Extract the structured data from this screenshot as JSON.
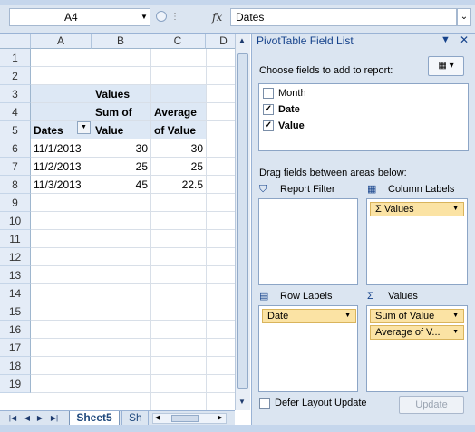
{
  "formula_bar": {
    "name_box": "A4",
    "fx_label": "fx",
    "formula": "Dates"
  },
  "grid": {
    "columns": [
      "A",
      "B",
      "C",
      "D"
    ],
    "rows": [
      "1",
      "2",
      "3",
      "4",
      "5",
      "6",
      "7",
      "8",
      "9",
      "10",
      "11",
      "12",
      "13",
      "14",
      "15",
      "16",
      "17",
      "18",
      "19"
    ],
    "pivot": {
      "values_header": "Values",
      "col_b_header_1": "Sum of",
      "col_b_header_2": "Value",
      "col_c_header_1": "Average",
      "col_c_header_2": "of Value",
      "row_label": "Dates",
      "data": [
        {
          "date": "11/1/2013",
          "sum": "30",
          "avg": "30"
        },
        {
          "date": "11/2/2013",
          "sum": "25",
          "avg": "25"
        },
        {
          "date": "11/3/2013",
          "sum": "45",
          "avg": "22.5"
        }
      ]
    }
  },
  "sheet_tabs": {
    "active": "Sheet5",
    "other": "Sh"
  },
  "pivot_pane": {
    "title": "PivotTable Field List",
    "choose_label": "Choose fields to add to report:",
    "fields": [
      {
        "name": "Month",
        "checked": false
      },
      {
        "name": "Date",
        "checked": true
      },
      {
        "name": "Value",
        "checked": true
      }
    ],
    "drag_label": "Drag fields between areas below:",
    "areas": {
      "report_filter": "Report Filter",
      "column_labels": "Column Labels",
      "row_labels": "Row Labels",
      "values": "Values"
    },
    "column_items": [
      "Values"
    ],
    "row_items": [
      "Date"
    ],
    "value_items": [
      "Sum of Value",
      "Average of V..."
    ],
    "defer_label": "Defer Layout Update",
    "update_label": "Update"
  },
  "colors": {
    "accent": "#15428b",
    "pill": "#fbe3a4",
    "pivot_shade": "#dde8f5"
  }
}
